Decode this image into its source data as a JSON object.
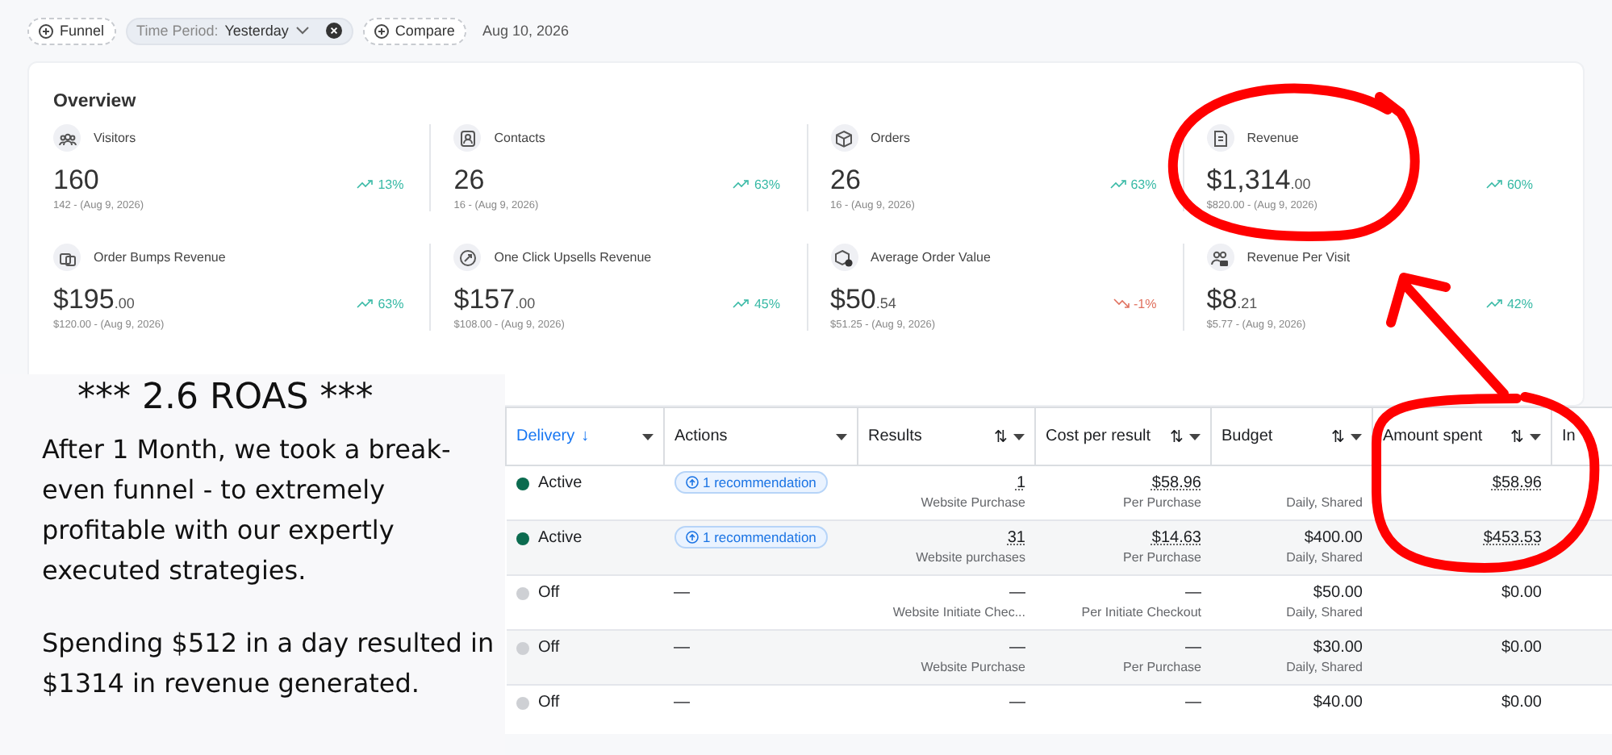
{
  "filters": [
    {
      "kind": "add",
      "label": "Funnel"
    },
    {
      "kind": "select",
      "label": "Time Period:",
      "value": "Yesterday"
    },
    {
      "kind": "add",
      "label": "Compare"
    }
  ],
  "date": "Aug 10, 2026",
  "overview": {
    "title": "Overview",
    "metrics": [
      {
        "label": "Visitors",
        "value": "160",
        "kind": "up",
        "change": "13%",
        "previous": "142 - (Aug 9, 2026)"
      },
      {
        "label": "Contacts",
        "value": "26",
        "kind": "up",
        "change": "63%",
        "previous": "16 - (Aug 9, 2026)"
      },
      {
        "label": "Orders",
        "value": "26",
        "kind": "up",
        "change": "63%",
        "previous": "16 - (Aug 9, 2026)"
      },
      {
        "label": "Revenue",
        "value": "$1,314",
        "cents": ".00",
        "kind": "up",
        "change": "60%",
        "previous": "$820.00 - (Aug 9, 2026)"
      },
      {
        "label": "Order Bumps Revenue",
        "value": "$195",
        "cents": ".00",
        "kind": "up",
        "change": "63%",
        "previous": "$120.00 - (Aug 9, 2026)"
      },
      {
        "label": "One Click Upsells Revenue",
        "value": "$157",
        "cents": ".00",
        "kind": "up",
        "change": "45%",
        "previous": "$108.00 - (Aug 9, 2026)"
      },
      {
        "label": "Average Order Value",
        "value": "$50",
        "cents": ".54",
        "kind": "down",
        "change": "-1%",
        "previous": "$51.25 - (Aug 9, 2026)"
      },
      {
        "label": "Revenue Per Visit",
        "value": "$8",
        "cents": ".21",
        "kind": "up",
        "change": "42%",
        "previous": "$5.77 - (Aug 9, 2026)"
      }
    ]
  },
  "promo": {
    "heading": "*** 2.6 ROAS ***",
    "paragraphs": [
      "After 1 Month, we took a break-even funnel - to extremely profitable with our expertly executed strategies.",
      "Spending $512 in a day resulted in $1314 in revenue generated."
    ]
  },
  "table": {
    "columns": [
      {
        "label": "Delivery",
        "sort": "↓",
        "selected": true
      },
      {
        "label": "Actions",
        "selected": false
      },
      {
        "label": "Results",
        "sort": "⇅",
        "selected": false
      },
      {
        "label": "Cost per result",
        "sort": "⇅",
        "selected": false
      },
      {
        "label": "Budget",
        "sort": "⇅",
        "selected": false
      },
      {
        "label": "Amount spent",
        "sort": "⇅",
        "selected": false
      },
      {
        "label": "In",
        "selected": false
      }
    ],
    "rows": [
      {
        "active": true,
        "status": "Active",
        "action": "1 recommendation",
        "results": {
          "text": "1",
          "sub": "Website Purchase",
          "dotted": true
        },
        "cost": {
          "text": "$58.96",
          "sub": "Per Purchase",
          "dotted": true
        },
        "budget": {
          "sub": "Daily, Shared"
        },
        "spent": {
          "text": "$58.96",
          "dotted": true
        }
      },
      {
        "active": true,
        "status": "Active",
        "action": "1 recommendation",
        "results": {
          "text": "31",
          "sub": "Website purchases",
          "dotted": true
        },
        "cost": {
          "text": "$14.63",
          "sub": "Per Purchase",
          "dotted": true
        },
        "budget": {
          "text": "$400.00",
          "sub": "Daily, Shared"
        },
        "spent": {
          "text": "$453.53",
          "dotted": true
        }
      },
      {
        "active": false,
        "status": "Off",
        "action": "—",
        "results": {
          "text": "—",
          "sub": "Website Initiate Chec...",
          "dotted": false
        },
        "cost": {
          "text": "—",
          "sub": "Per Initiate Checkout",
          "dotted": false
        },
        "budget": {
          "text": "$50.00",
          "sub": "Daily, Shared"
        },
        "spent": {
          "text": "$0.00",
          "dotted": false
        }
      },
      {
        "active": false,
        "status": "Off",
        "action": "—",
        "results": {
          "text": "—",
          "sub": "Website Purchase",
          "dotted": false
        },
        "cost": {
          "text": "—",
          "sub": "Per Purchase",
          "dotted": false
        },
        "budget": {
          "text": "$30.00",
          "sub": "Daily, Shared"
        },
        "spent": {
          "text": "$0.00",
          "dotted": false
        }
      },
      {
        "active": false,
        "status": "Off",
        "action": "—",
        "results": {
          "text": "—",
          "dotted": false
        },
        "cost": {
          "text": "—",
          "dotted": false
        },
        "budget": {
          "text": "$40.00"
        },
        "spent": {
          "text": "$0.00",
          "dotted": false
        }
      }
    ]
  }
}
